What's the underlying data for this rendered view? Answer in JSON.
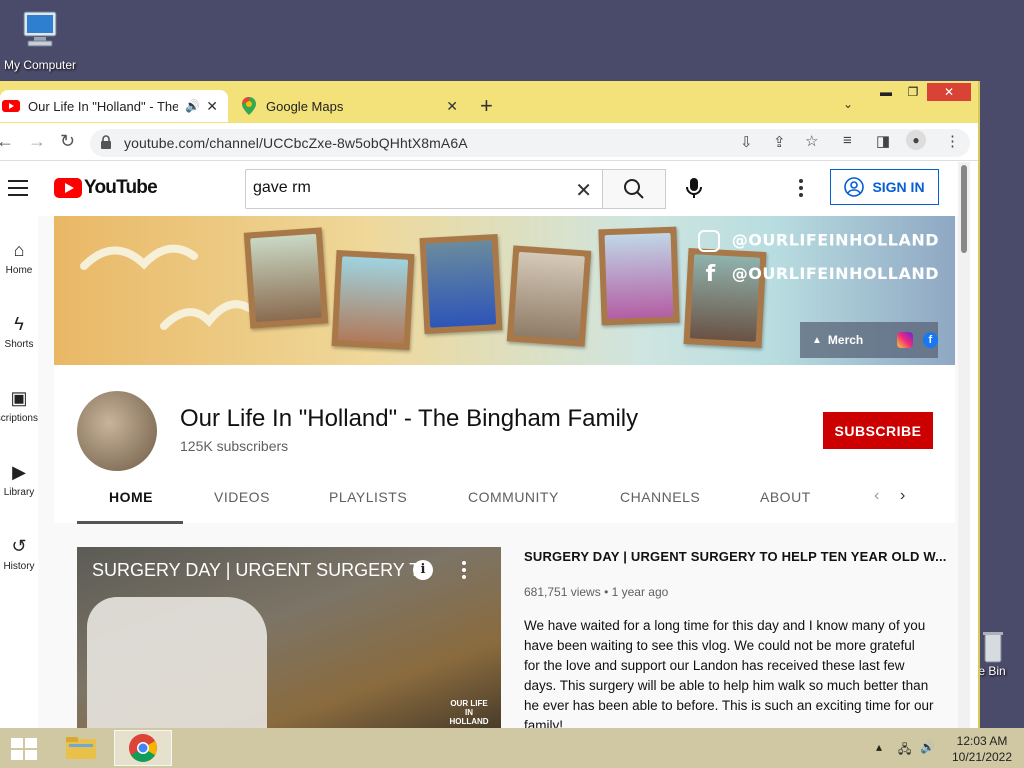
{
  "desktop": {
    "my_computer_label": "My Computer",
    "recycle_bin_label": "e Bin"
  },
  "browser": {
    "tabs": [
      {
        "title": "Our Life In \"Holland\" - The Bi",
        "active": true
      },
      {
        "title": "Google Maps",
        "active": false
      }
    ],
    "url": "youtube.com/channel/UCCbcZxe-8w5obQHhtX8mA6A"
  },
  "youtube": {
    "logo_text": "YouTube",
    "search_value": "gave rm",
    "signin_label": "SIGN IN",
    "sidebar": [
      {
        "label": "Home",
        "icon": "home-icon"
      },
      {
        "label": "Shorts",
        "icon": "shorts-icon"
      },
      {
        "label": "Subscriptions",
        "icon": "subscriptions-icon"
      },
      {
        "label": "Library",
        "icon": "library-icon"
      },
      {
        "label": "History",
        "icon": "history-icon"
      }
    ],
    "banner": {
      "instagram_handle": "@OURLIFEINHOLLAND",
      "facebook_handle": "@OURLIFEINHOLLAND",
      "merch_label": "Merch"
    },
    "channel": {
      "name": "Our Life In \"Holland\" - The Bingham Family",
      "subscribers": "125K subscribers",
      "subscribe_label": "SUBSCRIBE"
    },
    "channel_tabs": [
      "HOME",
      "VIDEOS",
      "PLAYLISTS",
      "COMMUNITY",
      "CHANNELS",
      "ABOUT"
    ],
    "featured_video": {
      "thumb_title": "SURGERY DAY | URGENT SURGERY T...",
      "title": "SURGERY DAY | URGENT SURGERY TO HELP TEN YEAR OLD W...",
      "views": "681,751 views",
      "age": "1 year ago",
      "description": "We have waited for a long time for this day and I know many of you have been waiting to see this vlog. We could not be more grateful for the love and support our Landon has received these last few days. This surgery will be able to help him walk so much better than he ever has been able to before. This is such an exciting time for our family!",
      "ellipsis": "...",
      "watermark": "OUR LIFE IN HOLLAND"
    }
  },
  "taskbar": {
    "time": "12:03 AM",
    "date": "10/21/2022"
  }
}
